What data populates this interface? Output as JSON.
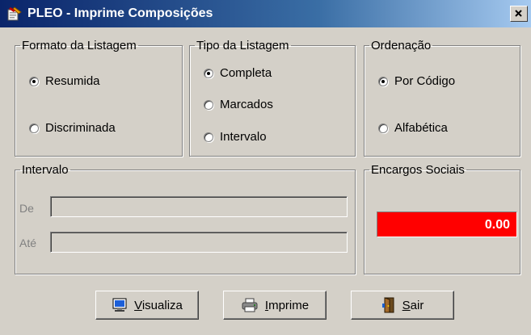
{
  "window": {
    "title": "PLEO - Imprime Composições",
    "close_glyph": "×"
  },
  "formato": {
    "legend": "Formato da Listagem",
    "options": [
      {
        "label": "Resumida",
        "selected": true
      },
      {
        "label": "Discriminada",
        "selected": false
      }
    ]
  },
  "tipo": {
    "legend": "Tipo da Listagem",
    "options": [
      {
        "label": "Completa",
        "selected": true
      },
      {
        "label": "Marcados",
        "selected": false
      },
      {
        "label": "Intervalo",
        "selected": false
      }
    ]
  },
  "ordenacao": {
    "legend": "Ordenação",
    "options": [
      {
        "label": "Por Código",
        "selected": true
      },
      {
        "label": "Alfabética",
        "selected": false
      }
    ]
  },
  "intervalo": {
    "legend": "Intervalo",
    "de_label": "De",
    "ate_label": "Até",
    "de_value": "",
    "ate_value": ""
  },
  "encargos": {
    "legend": "Encargos Sociais",
    "value": "0.00",
    "color": "#ff0000"
  },
  "buttons": {
    "visualiza": {
      "mnemonic": "V",
      "rest": "isualiza",
      "icon": "monitor-icon"
    },
    "imprime": {
      "mnemonic": "I",
      "rest": "mprime",
      "icon": "printer-icon"
    },
    "sair": {
      "mnemonic": "S",
      "rest": "air",
      "icon": "door-icon"
    }
  }
}
